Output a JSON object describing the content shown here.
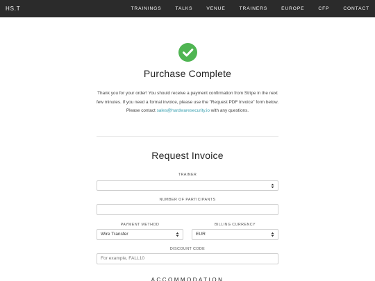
{
  "nav": {
    "brand": "HS.T",
    "links": [
      "TRAININGS",
      "TALKS",
      "VENUE",
      "TRAINERS",
      "EUROPE",
      "CFP",
      "CONTACT"
    ]
  },
  "icons": {
    "status": "check-circle-icon",
    "select_arrows": "chevron-up-down-icon"
  },
  "colors": {
    "navbar_bg": "#2b2b2b",
    "success": "#4fb552",
    "link": "#3aa0b0"
  },
  "confirmation": {
    "title": "Purchase Complete",
    "message_before": "Thank you for your order! You should receive a payment confirmation from Stripe in the next few minutes. If you need a formal invoice, please use the \"Request PDF Invoice\" form below. Please contact ",
    "email": "sales@hardwaresecurity.io",
    "message_after": " with any questions."
  },
  "invoice_form": {
    "title": "Request Invoice",
    "trainer_label": "TRAINER",
    "trainer_value": "",
    "participants_label": "NUMBER OF PARTICIPANTS",
    "participants_value": "",
    "payment_method_label": "PAYMENT METHOD",
    "payment_method_value": "Wire Transfer",
    "currency_label": "BILLING CURRENCY",
    "currency_value": "EUR",
    "discount_label": "DISCOUNT CODE",
    "discount_placeholder": "For example, FALL10"
  },
  "next_section": {
    "title": "ACCOMMODATION"
  }
}
